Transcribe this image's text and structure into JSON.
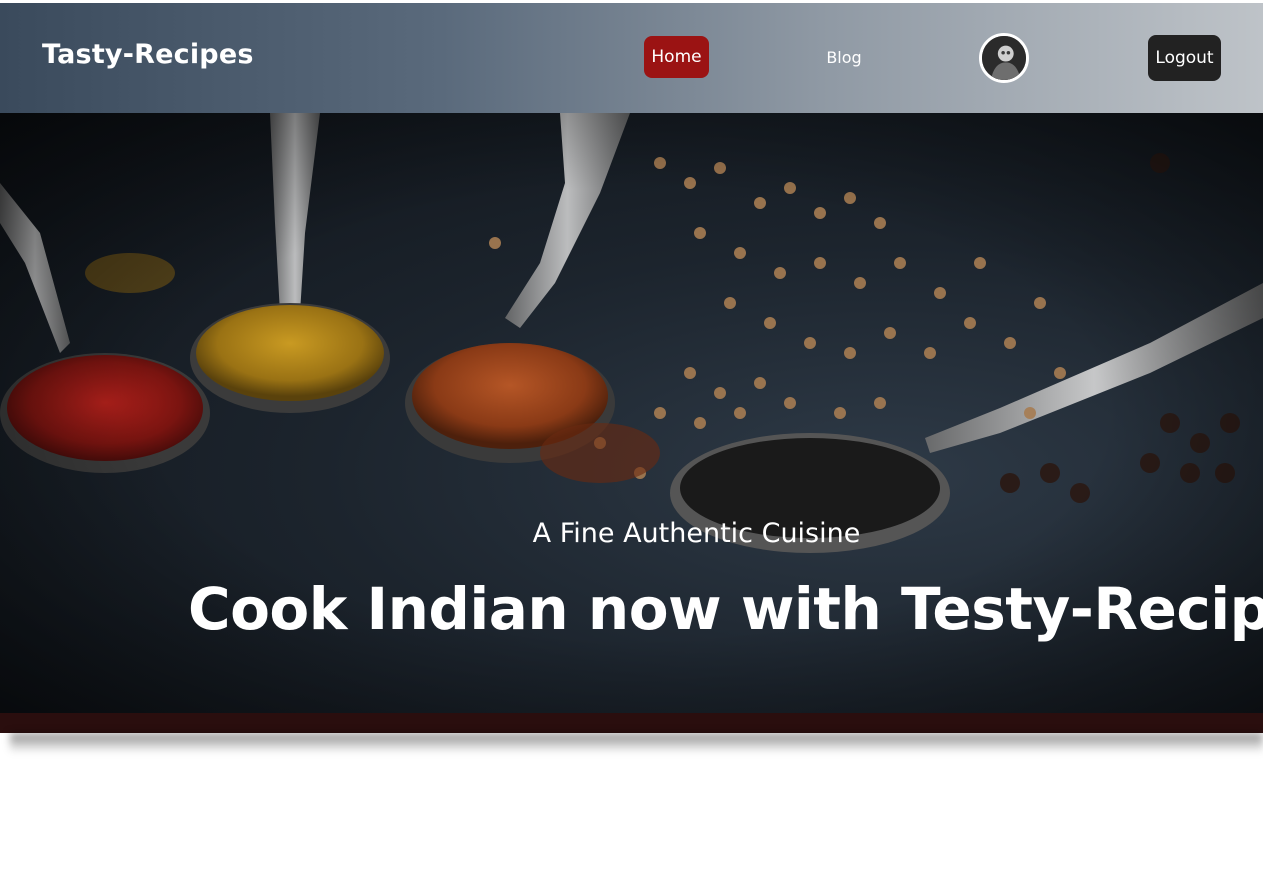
{
  "navbar": {
    "brand": "Tasty-Recipes",
    "links": [
      {
        "label": "Home",
        "active": true
      },
      {
        "label": "Blog",
        "active": false
      }
    ],
    "logout_label": "Logout",
    "active_color": "#9b1313",
    "logout_color": "#222222"
  },
  "hero": {
    "subtitle": "A Fine Authentic Cuisine",
    "title": "Cook Indian now with Testy-Recipes",
    "background_description_icon": "spices-spoons-image",
    "bottom_bar_color": "#2a0e0e"
  }
}
